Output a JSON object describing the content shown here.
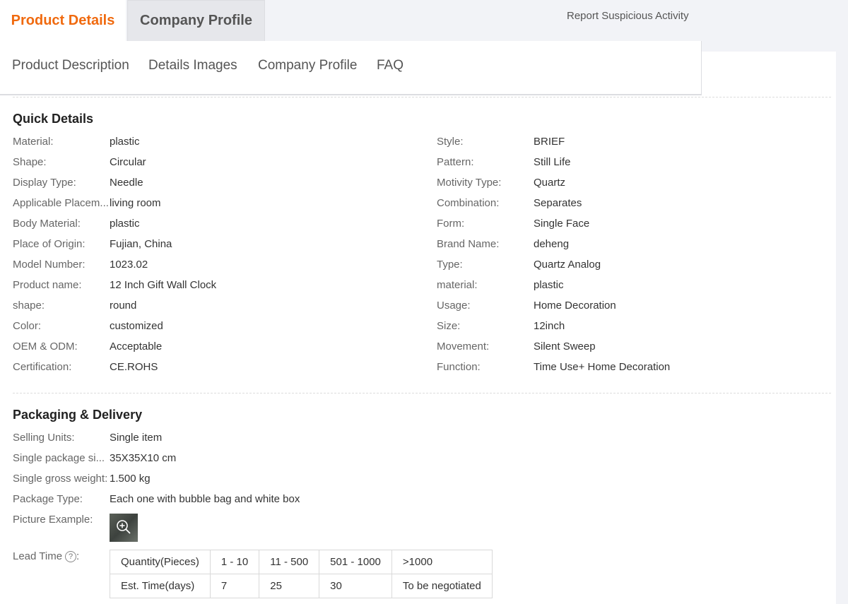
{
  "tabs": {
    "product_details": "Product Details",
    "company_profile": "Company Profile"
  },
  "report_link": "Report Suspicious Activity",
  "subnav": [
    "Product Description",
    "Details Images",
    "Company Profile",
    "FAQ"
  ],
  "quick_details": {
    "title": "Quick Details",
    "left": [
      {
        "label": "Material:",
        "value": "plastic"
      },
      {
        "label": "Shape:",
        "value": "Circular"
      },
      {
        "label": "Display Type:",
        "value": "Needle"
      },
      {
        "label": "Applicable Placem...",
        "value": "living room"
      },
      {
        "label": "Body Material:",
        "value": "plastic"
      },
      {
        "label": "Place of Origin:",
        "value": "Fujian, China"
      },
      {
        "label": "Model Number:",
        "value": "1023.02"
      },
      {
        "label": "Product name:",
        "value": "12 Inch Gift Wall Clock"
      },
      {
        "label": "shape:",
        "value": "round"
      },
      {
        "label": "Color:",
        "value": "customized"
      },
      {
        "label": "OEM & ODM:",
        "value": "Acceptable"
      },
      {
        "label": "Certification:",
        "value": "CE.ROHS"
      }
    ],
    "right": [
      {
        "label": "Style:",
        "value": "BRIEF"
      },
      {
        "label": "Pattern:",
        "value": "Still Life"
      },
      {
        "label": "Motivity Type:",
        "value": "Quartz"
      },
      {
        "label": "Combination:",
        "value": "Separates"
      },
      {
        "label": "Form:",
        "value": "Single Face"
      },
      {
        "label": "Brand Name:",
        "value": "deheng"
      },
      {
        "label": "Type:",
        "value": "Quartz Analog"
      },
      {
        "label": "material:",
        "value": "plastic"
      },
      {
        "label": "Usage:",
        "value": "Home Decoration"
      },
      {
        "label": "Size:",
        "value": "12inch"
      },
      {
        "label": "Movement:",
        "value": "Silent Sweep"
      },
      {
        "label": "Function:",
        "value": "Time Use+ Home Decoration"
      }
    ]
  },
  "packaging": {
    "title": "Packaging & Delivery",
    "rows": [
      {
        "label": "Selling Units:",
        "value": "Single item"
      },
      {
        "label": "Single package si...",
        "value": "35X35X10 cm"
      },
      {
        "label": "Single gross weight:",
        "value": "1.500 kg"
      },
      {
        "label": "Package Type:",
        "value": "Each one with bubble bag and white box"
      }
    ],
    "picture_label": "Picture Example:",
    "lead_time_label": "Lead Time",
    "lead_time_suffix": ":",
    "help_glyph": "?",
    "lead_table": {
      "header": [
        "Quantity(Pieces)",
        "1 - 10",
        "11 - 500",
        "501 - 1000",
        ">1000"
      ],
      "row": [
        "Est. Time(days)",
        "7",
        "25",
        "30",
        "To be negotiated"
      ]
    }
  }
}
